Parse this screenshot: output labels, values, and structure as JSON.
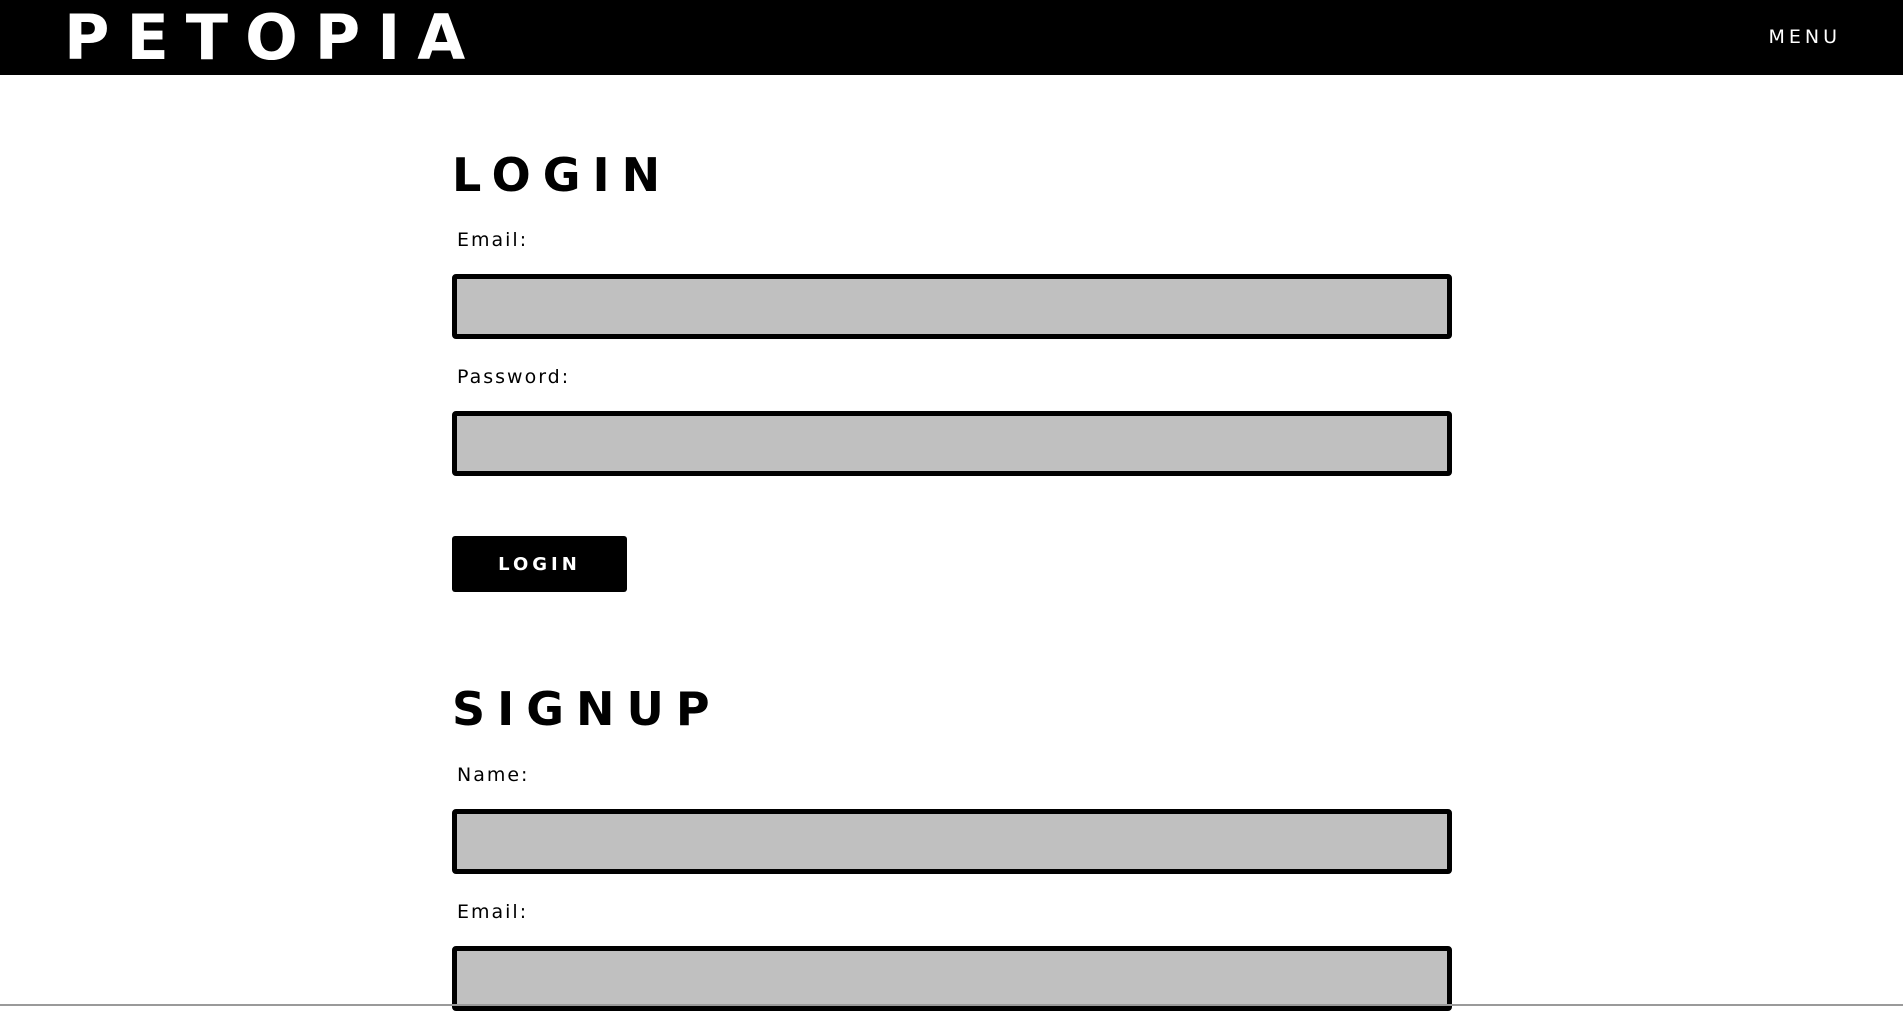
{
  "header": {
    "logo": "PETOPIA",
    "menu_label": "MENU"
  },
  "login": {
    "title": "LOGIN",
    "email_label": "Email:",
    "email_value": "",
    "password_label": "Password:",
    "password_value": "",
    "submit_label": "LOGIN"
  },
  "signup": {
    "title": "SIGNUP",
    "name_label": "Name:",
    "name_value": "",
    "email_label": "Email:",
    "email_value": ""
  },
  "colors": {
    "header_bg": "#000000",
    "field_bg": "#c0c0c0",
    "field_border": "#000000",
    "button_bg": "#000000",
    "button_text": "#ffffff"
  }
}
